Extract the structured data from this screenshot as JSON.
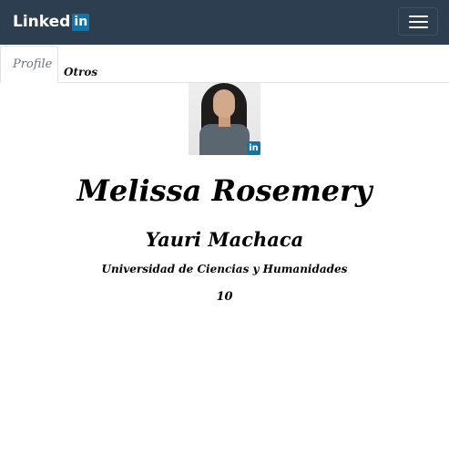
{
  "navbar": {
    "brand_text": "Linked",
    "brand_badge": "in",
    "toggle_icon": "hamburger-menu-icon"
  },
  "tabs": [
    {
      "label": "Profile",
      "active": true
    },
    {
      "label": "Otros",
      "active": false
    }
  ],
  "profile": {
    "avatar_badge": "in",
    "first_names": "Melissa Rosemery",
    "last_names": "Yauri Machaca",
    "university": "Universidad de Ciencias y Humanidades",
    "score": "10"
  },
  "colors": {
    "navbar_bg": "#2c3e50",
    "linkedin_blue": "#0e76a8"
  }
}
